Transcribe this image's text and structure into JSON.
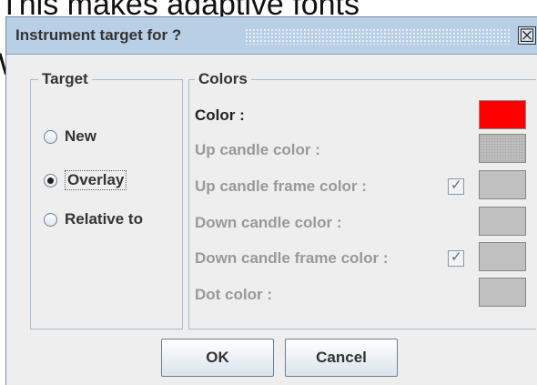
{
  "background": {
    "line1": "This makes adaptive fonts",
    "line2_fragment": "W"
  },
  "dialog": {
    "title": "Instrument target for ?",
    "close_glyph": "☒",
    "target": {
      "legend": "Target",
      "options": [
        {
          "label": "New",
          "selected": false
        },
        {
          "label": "Overlay",
          "selected": true
        },
        {
          "label": "Relative to",
          "selected": false
        }
      ]
    },
    "colors": {
      "legend": "Colors",
      "rows": [
        {
          "label": "Color :",
          "enabled": true,
          "swatch": "#ff0000",
          "checkbox": false
        },
        {
          "label": "Up candle color :",
          "enabled": false,
          "swatch": "#c0c0c0",
          "checkbox": false
        },
        {
          "label": "Up candle frame color :",
          "enabled": false,
          "swatch": "#c0c0c0",
          "checkbox": true
        },
        {
          "label": "Down candle color :",
          "enabled": false,
          "swatch": "#c0c0c0",
          "checkbox": false
        },
        {
          "label": "Down candle frame color :",
          "enabled": false,
          "swatch": "#c0c0c0",
          "checkbox": true
        },
        {
          "label": "Dot color :",
          "enabled": false,
          "swatch": "#c0c0c0",
          "checkbox": false
        }
      ],
      "check_glyph": "✓"
    },
    "buttons": {
      "ok": "OK",
      "cancel": "Cancel"
    }
  }
}
